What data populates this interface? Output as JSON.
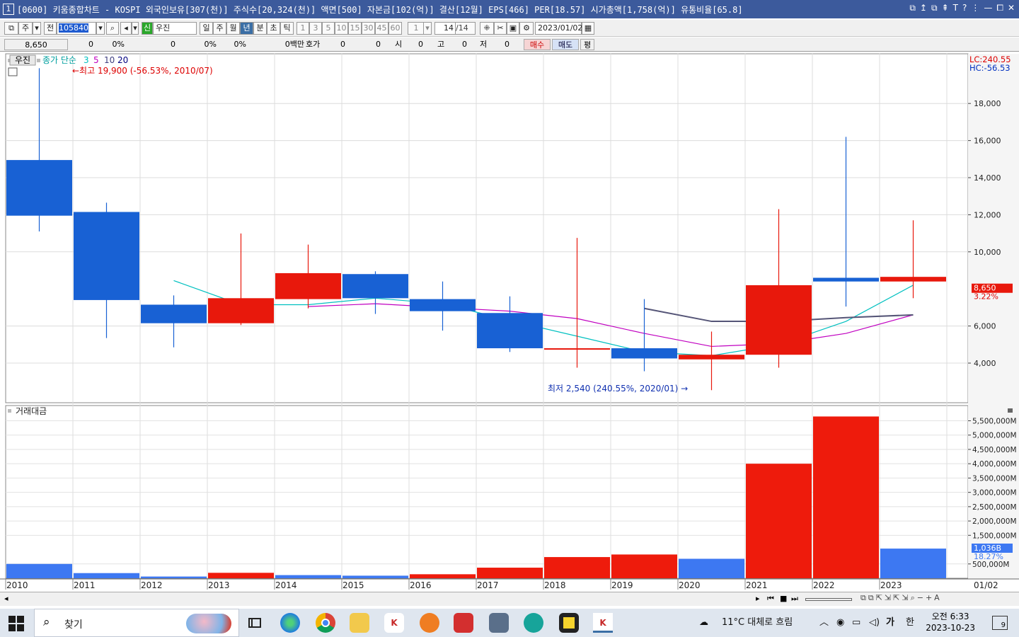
{
  "window": {
    "number": "1",
    "title": "[0600] 키움종합차트 - KOSPI 외국인보유[307(천)] 주식수[20,324(천)] 액면[500] 자본금[102(억)] 결산[12월] EPS[466] PER[18.57] 시가총액[1,758(억)] 유통비율[65.8]",
    "buttons": [
      "⧉",
      "↥",
      "⧉",
      "⇞",
      "T",
      "?",
      "⋮",
      "—",
      "⧠",
      "✕"
    ]
  },
  "toolbar": {
    "type1": "주",
    "type2": "전",
    "stock_code": "105840",
    "sin_badge": "신",
    "stock_name": "우진",
    "periods": [
      "일",
      "주",
      "월",
      "년",
      "분",
      "초",
      "틱"
    ],
    "selected_period": "년",
    "intervals": [
      "1",
      "3",
      "5",
      "10",
      "15",
      "30",
      "45",
      "60"
    ],
    "interval_value": "1",
    "page_count": "14",
    "page_total": "/14",
    "date": "2023/01/02"
  },
  "quote_bar": {
    "price": "8,650",
    "change": "0",
    "change_pct": "0%",
    "vol": "0",
    "vol_pct": "0%",
    "extra_pct": "0%",
    "money": "0백만",
    "hoga_label": "호가",
    "hoga_value": "0",
    "v2": "0",
    "si_label": "시",
    "si_value": "0",
    "go_label": "고",
    "go_value": "0",
    "jeo_label": "저",
    "jeo_value": "0",
    "buy_label": "매수",
    "sell_label": "매도",
    "avg_label": "평"
  },
  "price_chart": {
    "legend_name": "우진",
    "legend_ma_label": "종가 단순",
    "ma_periods": [
      {
        "label": "3",
        "color": "#00c0c0"
      },
      {
        "label": "5",
        "color": "#c000c0"
      },
      {
        "label": "10",
        "color": "#404080"
      },
      {
        "label": "20",
        "color": "#000080"
      }
    ],
    "high_annotation": "←최고 19,900 (-56.53%, 2010/07)",
    "low_annotation": "최저 2,540 (240.55%, 2020/01) →",
    "lc_text": "LC:240.55",
    "hc_text": "HC:-56.53",
    "current_price_label": "8,650",
    "current_pct_label": "3.22%",
    "y_ticks": [
      "18,000",
      "16,000",
      "14,000",
      "12,000",
      "10,000",
      "6,000",
      "4,000"
    ]
  },
  "volume_chart": {
    "legend": "거래대금",
    "y_ticks": [
      "5,500,000M",
      "5,000,000M",
      "4,500,000M",
      "4,000,000M",
      "3,500,000M",
      "3,000,000M",
      "2,500,000M",
      "2,000,000M",
      "1,500,000M",
      "500,000M"
    ],
    "current_label": "1,036B",
    "current_pct": "18.27%"
  },
  "x_axis": {
    "labels": [
      "2010",
      "2011",
      "2012",
      "2013",
      "2014",
      "2015",
      "2016",
      "2017",
      "2018",
      "2019",
      "2020",
      "2021",
      "2022",
      "2023"
    ],
    "right_label": "01/02"
  },
  "chart_data": {
    "type": "candlestick",
    "years": [
      "2010",
      "2011",
      "2012",
      "2013",
      "2014",
      "2015",
      "2016",
      "2017",
      "2018",
      "2019",
      "2020",
      "2021",
      "2022",
      "2023"
    ],
    "open": [
      14950,
      12150,
      7150,
      6150,
      8850,
      8800,
      7450,
      6700,
      4750,
      4800,
      4450,
      8200,
      8600,
      8650
    ],
    "high": [
      19900,
      12650,
      7650,
      10990,
      10390,
      8950,
      8400,
      7600,
      10750,
      7450,
      5700,
      12300,
      16200,
      11700
    ],
    "low": [
      11100,
      5350,
      4850,
      6050,
      6950,
      6650,
      5750,
      4600,
      3750,
      3560,
      2540,
      3750,
      7050,
      7500
    ],
    "close": [
      11950,
      7400,
      6150,
      7500,
      7450,
      7500,
      6800,
      4800,
      4800,
      4250,
      4200,
      4450,
      8400,
      8400
    ],
    "rising": [
      false,
      false,
      false,
      true,
      true,
      false,
      false,
      false,
      true,
      false,
      true,
      true,
      false,
      true
    ],
    "ma3": [
      null,
      null,
      8450,
      7150,
      7150,
      7500,
      7200,
      6300,
      5450,
      4600,
      4400,
      5000,
      6250,
      8200
    ],
    "ma5": [
      null,
      null,
      null,
      null,
      7050,
      7200,
      7000,
      6800,
      6400,
      5600,
      4900,
      5050,
      5600,
      6600
    ],
    "ma10": [
      null,
      null,
      null,
      null,
      null,
      null,
      null,
      null,
      null,
      6950,
      6250,
      6250,
      6450,
      6600
    ],
    "ylim": [
      2000,
      20000
    ],
    "volume_million": [
      500000,
      180000,
      60000,
      190000,
      110000,
      90000,
      140000,
      370000,
      740000,
      830000,
      680000,
      4000000,
      5650000,
      1036000
    ],
    "volume_rising": [
      false,
      false,
      false,
      true,
      false,
      false,
      true,
      true,
      true,
      true,
      false,
      true,
      true,
      false
    ],
    "volume_ylim": [
      0,
      6000000
    ]
  },
  "taskbar": {
    "search_label": "찾기",
    "weather": "11°C 대체로 흐림",
    "ime1": "가",
    "ime2": "한",
    "time": "오전 6:33",
    "date": "2023-10-23",
    "notif_count": "9"
  }
}
